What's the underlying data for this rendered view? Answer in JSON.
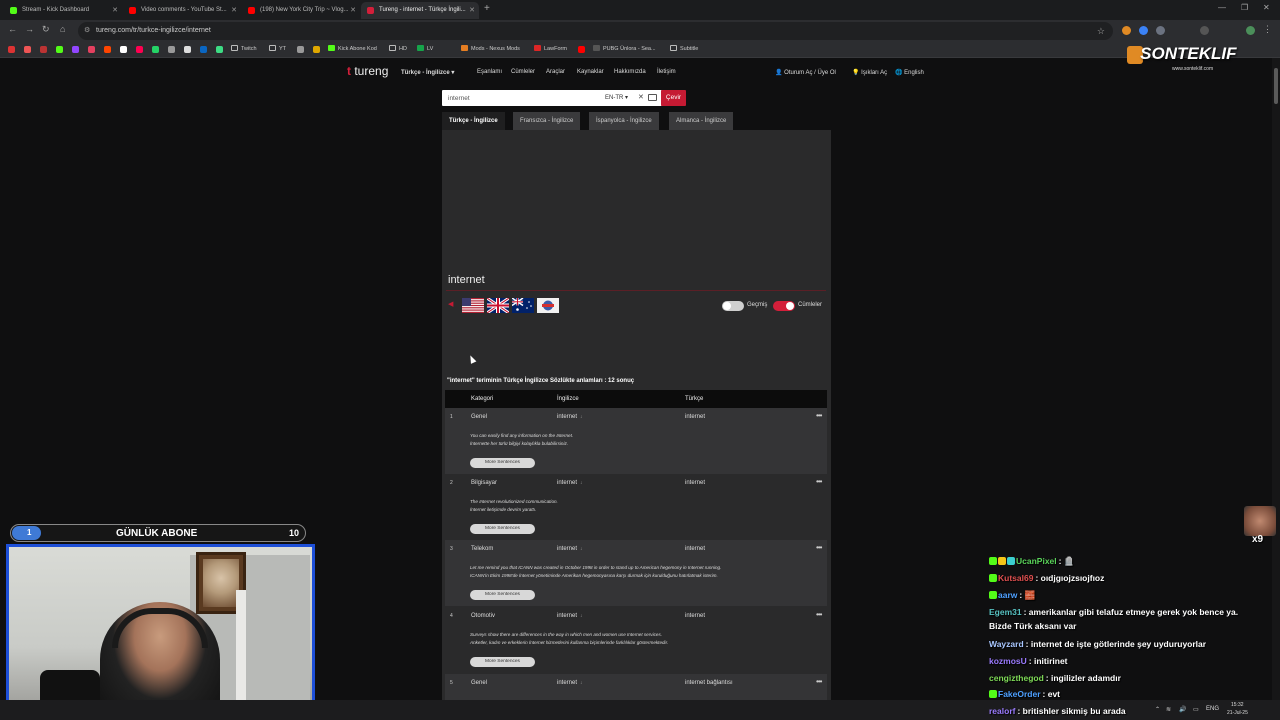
{
  "browser": {
    "tabs": [
      {
        "title": "Stream - Kick Dashboard",
        "color": "#53fc18"
      },
      {
        "title": "Video comments - YouTube St...",
        "color": "#ff0000"
      },
      {
        "title": "(198) New York City Trip ~ Vlog...",
        "color": "#ff0000"
      },
      {
        "title": "Tureng - internet - Türkçe İngili...",
        "color": "#d31f3a"
      }
    ],
    "url": "tureng.com/tr/turkce-ingilizce/internet",
    "bookmarks": [
      "Twitch",
      "YT",
      "Kick Abone Kod",
      "HD",
      "LV",
      "Mods - Nexus Mods",
      "LawForm",
      "PUBG Ünlora - Sea...",
      "Subtitle"
    ]
  },
  "site": {
    "logo_t": "t",
    "logo_text": "tureng",
    "nav": [
      "Türkçe - İngilizce ▾",
      "Eşanlamı",
      "Cümleler",
      "Araçlar",
      "Kaynaklar",
      "Hakkımızda",
      "İletişim"
    ],
    "nav_right": [
      "Oturum Aç / Üye Ol",
      "Işıkları Aç",
      "English"
    ],
    "search_value": "internet",
    "lang_select": "EN-TR ▾",
    "clear": "✕",
    "translate_button": "Çevir",
    "lang_tabs": [
      "Türkçe - İngilizce",
      "Fransızca - İngilizce",
      "İspanyolca - İngilizce",
      "Almanca - İngilizce"
    ],
    "word": "internet",
    "toggle_history": "Geçmiş",
    "toggle_sentences": "Cümleler",
    "result_header": "\"internet\" teriminin Türkçe İngilizce Sözlükte anlamları : 12 sonuç",
    "columns": [
      "Kategori",
      "İngilizce",
      "Türkçe"
    ],
    "more_label": "More Sentences",
    "rows": [
      {
        "n": "1",
        "category": "Genel",
        "en": "internet",
        "tr": "internet",
        "ex1": "You can easily find any information on the Internet.",
        "ex2": "İnternette her türlü bilgiyi kolaylıkla bulabilirsiniz."
      },
      {
        "n": "2",
        "category": "Bilgisayar",
        "en": "internet",
        "tr": "internet",
        "ex1": "The Internet revolutionized communication.",
        "ex2": "İnternet iletişimde devrim yarattı."
      },
      {
        "n": "3",
        "category": "Telekom",
        "en": "internet",
        "tr": "internet",
        "ex1": "Let me remind you that ICANN was created in October 1998 in order to stand up to American hegemony in Internet running.",
        "ex2": "ICANN'in Ekim 1998'de İnternet yönetiminde Amerikan hegemonyasına karşı durmak için kurulduğunu hatırlatmak isterim."
      },
      {
        "n": "4",
        "category": "Otomotiv",
        "en": "internet",
        "tr": "internet",
        "ex1": "Surveys show there are differences in the way in which men and women use Internet services.",
        "ex2": "Anketler, kadın ve erkeklerin İnternet hizmetlerini kullanma biçimlerinde farklılıklar göstermektedir."
      },
      {
        "n": "5",
        "category": "Genel",
        "en": "internet",
        "tr": "internet bağlantısı",
        "ex1": "",
        "ex2": ""
      }
    ]
  },
  "overlay": {
    "brand": "SONTEKLIF",
    "brand_sub": "www.sonteklif.com",
    "sub_label": "GÜNLÜK ABONE",
    "sub_current": "1",
    "sub_goal": "10",
    "sub_progress": 0.1,
    "emote_badge": "x9",
    "chat": [
      {
        "user": "UcanPixel",
        "color": "#5ad45a",
        "msg": ": 🪦"
      },
      {
        "user": "Kutsal69",
        "color": "#e05050",
        "msg": ": oıdjgıojzsıojfıoz"
      },
      {
        "user": "aarw",
        "color": "#4ea0ff",
        "msg": ": 🧱"
      },
      {
        "user": "Egem31",
        "color": "#57c2c2",
        "msg": ": amerikanlar gibi telafuz etmeye gerek yok bence ya.",
        "cont": "Bizde Türk aksanı var"
      },
      {
        "user": "Wayzard",
        "color": "#a9c7ff",
        "msg": ": internet de işte götlerinde şey uyduruyorlar"
      },
      {
        "user": "kozmosU",
        "color": "#9b7bff",
        "msg": ": initirinet"
      },
      {
        "user": "cengizthegod",
        "color": "#7ed957",
        "msg": ": ingilizler adamdır"
      },
      {
        "user": "FakeOrder",
        "color": "#4ea0ff",
        "msg": ": evt"
      },
      {
        "user": "realorf",
        "color": "#9b7bff",
        "msg": ": britishler sikmiş bu arada"
      }
    ]
  },
  "taskbar": {
    "lang": "ENG",
    "time": "15:32",
    "date": "21-Jul-25"
  }
}
